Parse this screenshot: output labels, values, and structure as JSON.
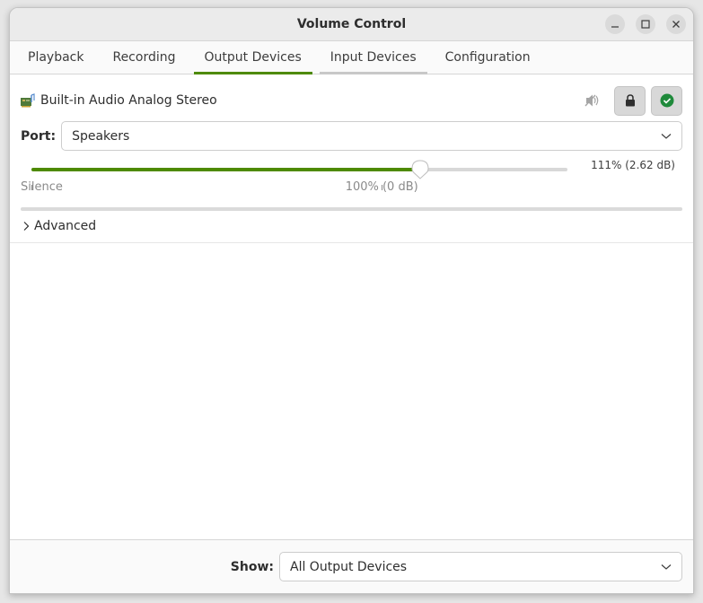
{
  "window": {
    "title": "Volume Control",
    "controls": [
      "minimize",
      "maximize",
      "close"
    ]
  },
  "tabs": [
    {
      "label": "Playback",
      "state": "normal"
    },
    {
      "label": "Recording",
      "state": "normal"
    },
    {
      "label": "Output Devices",
      "state": "active"
    },
    {
      "label": "Input Devices",
      "state": "hover"
    },
    {
      "label": "Configuration",
      "state": "normal"
    }
  ],
  "device": {
    "icon": "audio-card-icon",
    "name": "Built-in Audio Analog Stereo",
    "mute_icon": "speaker-muted-icon",
    "lock_icon": "lock-icon",
    "default_icon": "checkmark-circle-icon",
    "port_label": "Port:",
    "port_value": "Speakers"
  },
  "volume": {
    "percent": 111,
    "max_percent": 153,
    "value_label": "111% (2.62 dB)",
    "ticks": [
      {
        "label": "Silence",
        "percent": 0
      },
      {
        "label": "100% (0 dB)",
        "percent": 100
      }
    ]
  },
  "advanced": {
    "label": "Advanced",
    "expanded": false
  },
  "footer": {
    "show_label": "Show:",
    "show_value": "All Output Devices"
  },
  "colors": {
    "accent": "#4e8a00",
    "default_check": "#1f8a3b"
  }
}
